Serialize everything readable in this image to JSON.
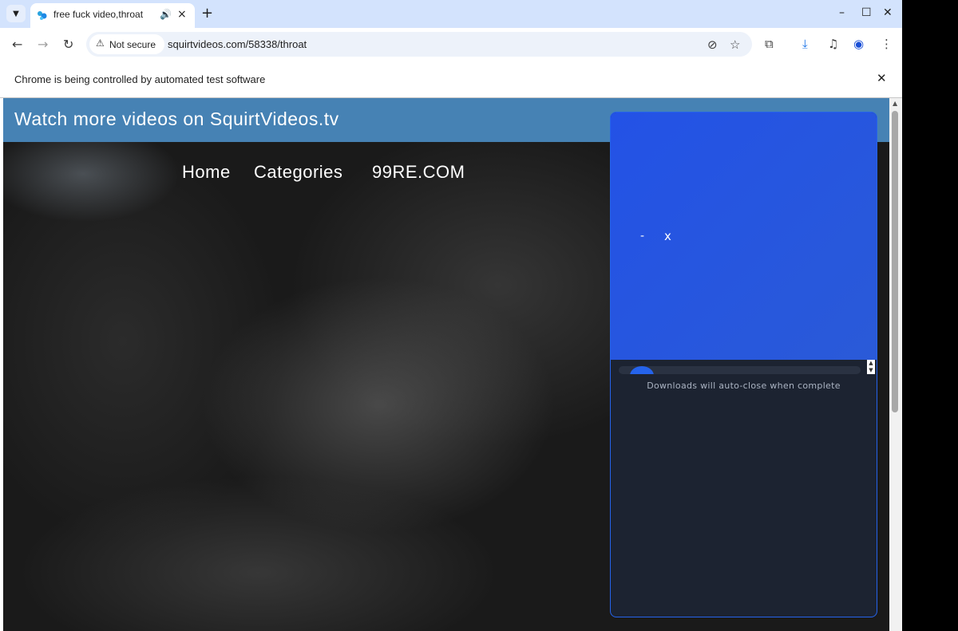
{
  "tab": {
    "title": "free fuck video,throat",
    "close": "×"
  },
  "new_tab": "+",
  "window_controls": {
    "minimize": "–",
    "maximize": "☐",
    "close": "✕"
  },
  "toolbar": {
    "back": "←",
    "forward": "→",
    "reload": "↻",
    "not_secure": "Not secure",
    "url": "squirtvideos.com/58338/throat"
  },
  "infobar": {
    "message": "Chrome is being controlled by automated test software",
    "close": "✕"
  },
  "page": {
    "banner": "Watch more videos on SquirtVideos.tv",
    "nav": [
      "Home",
      "Categories",
      "99RE.COM"
    ]
  },
  "popup": {
    "minimize": "-",
    "close": "x",
    "note": "Downloads will auto-close when complete",
    "accent_color": "#2563eb"
  }
}
